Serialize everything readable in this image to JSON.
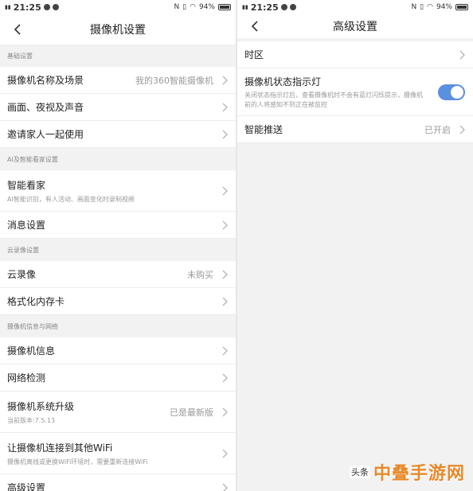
{
  "status": {
    "time": "21:25",
    "battery": "94%"
  },
  "left": {
    "title": "摄像机设置",
    "groups": [
      {
        "header": "基础设置",
        "items": [
          {
            "label": "摄像机名称及场景",
            "value": "我的360智能摄像机"
          },
          {
            "label": "画面、夜视及声音"
          },
          {
            "label": "邀请家人一起使用"
          }
        ]
      },
      {
        "header": "AI及智能看家设置",
        "items": [
          {
            "label": "智能看家",
            "sub": "AI智能识别，有人活动、画面变化时录制视频"
          },
          {
            "label": "消息设置"
          }
        ]
      },
      {
        "header": "云录像设置",
        "items": [
          {
            "label": "云录像",
            "value": "未购买"
          },
          {
            "label": "格式化内存卡"
          }
        ]
      },
      {
        "header": "摄像机信息与网络",
        "items": [
          {
            "label": "摄像机信息"
          },
          {
            "label": "网络检测"
          },
          {
            "label": "摄像机系统升级",
            "sub": "当前版本:7.5.13",
            "value": "已是最新版"
          },
          {
            "label": "让摄像机连接到其他WiFi",
            "sub": "摄像机离线或更换WiFi环境时，需要重新连接WiFi"
          },
          {
            "label": "高级设置"
          }
        ]
      }
    ]
  },
  "right": {
    "title": "高级设置",
    "items": [
      {
        "label": "时区"
      },
      {
        "label": "摄像机状态指示灯",
        "sub": "关闭状态指示灯后，查看摄像机时不会有蓝灯闪烁提示，摄像机前的人将感知不到正在被监控",
        "toggle_on": true
      },
      {
        "label": "智能推送",
        "value": "已开启"
      }
    ]
  },
  "watermark": {
    "small": "头条",
    "big": "中叠手游网"
  },
  "colors": {
    "toggle_on": "#5b8fe0",
    "watermark": "#e8892a"
  }
}
